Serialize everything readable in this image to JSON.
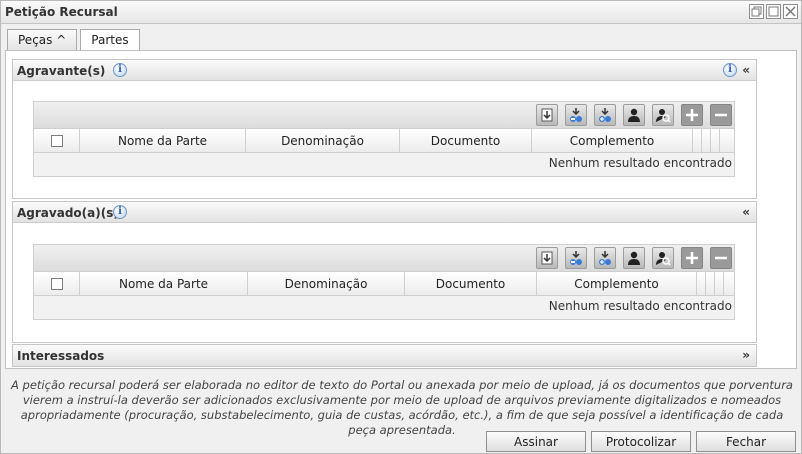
{
  "window": {
    "title": "Petição Recursal"
  },
  "tabs": [
    {
      "label": "Peças ^"
    },
    {
      "label": "Partes"
    }
  ],
  "sections": {
    "agravantes": {
      "title": "Agravante(s)",
      "toggle": "«"
    },
    "agravados": {
      "title": "Agravado(a)(s)",
      "toggle": "«"
    },
    "interessados": {
      "title": "Interessados",
      "toggle": "»"
    }
  },
  "grid": {
    "columns": [
      "Nome da Parte",
      "Denominação",
      "Documento",
      "Complemento"
    ],
    "empty_message": "Nenhum resultado encontrado"
  },
  "footer": {
    "note": "A petição recursal poderá ser elaborada no editor de texto do Portal ou anexada por meio de upload, já os documentos que porventura vierem a instruí-la deverão ser adicionados exclusivamente por meio de upload de arquivos previamente digitalizados e nomeados apropriadamente (procuração, substabelecimento, guia de custas, acórdão, etc.), a fim de que seja possível a identificação de cada peça apresentada."
  },
  "actions": {
    "assinar": "Assinar",
    "protocolizar": "Protocolizar",
    "fechar": "Fechar"
  },
  "icons": {
    "info": "info-icon",
    "toolbar": [
      "import-icon",
      "import-remove-icon",
      "import-add-icon",
      "person-icon",
      "person-search-icon",
      "plus-icon",
      "minus-icon"
    ]
  }
}
